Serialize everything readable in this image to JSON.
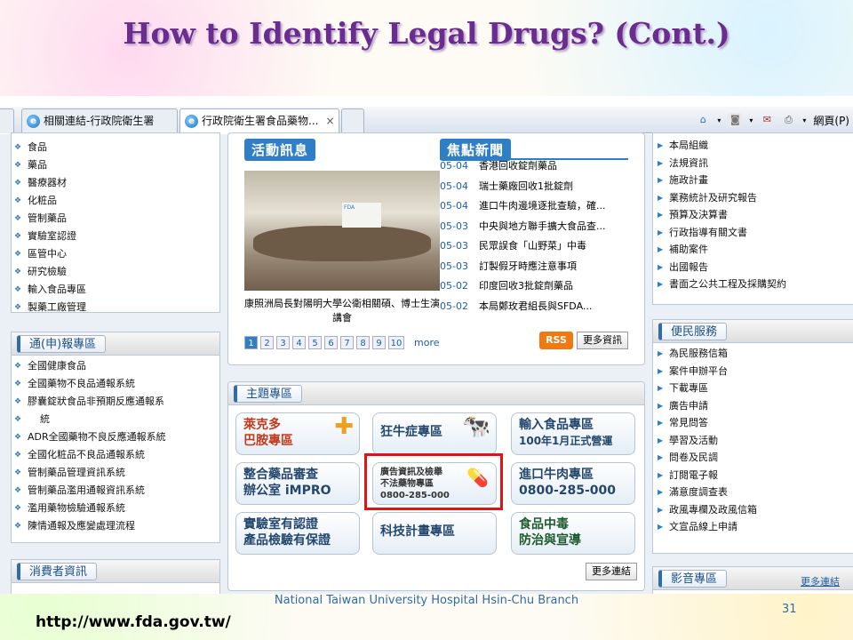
{
  "slide": {
    "title": "How to Identify Legal Drugs? (Cont.)",
    "footer": "National Taiwan University Hospital Hsin-Chu Branch",
    "page_number": "31",
    "url": "http://www.fda.gov.tw/"
  },
  "browser": {
    "tabs": [
      {
        "label": "相關連結-行政院衛生署"
      },
      {
        "label": "行政院衛生署食品藥物..."
      }
    ],
    "close": "×",
    "toolbar_page": "網頁(P)"
  },
  "left": {
    "top_items": [
      "食品",
      "藥品",
      "醫療器材",
      "化粧品",
      "管制藥品",
      "實驗室認證",
      "區管中心",
      "研究檢驗",
      "輸入食品專區",
      "製藥工廠管理"
    ],
    "report_title": "通(申)報專區",
    "report_items": [
      "全國健康食品",
      "全國藥物不良品通報系統",
      "膠囊錠狀食品非預期反應通報系",
      "統",
      "ADR全國藥物不良反應通報系統",
      "全國化粧品不良品通報系統",
      "管制藥品管理資訊系統",
      "管制藥品濫用通報資訊系統",
      "濫用藥物檢驗通報系統",
      "陳情通報及應變處理流程"
    ],
    "consumer_title": "消費者資訊"
  },
  "activity": {
    "title": "活動訊息",
    "caption": "康照洲局長對陽明大學公衛相關碩、博士生演講會",
    "pages": [
      "1",
      "2",
      "3",
      "4",
      "5",
      "6",
      "7",
      "8",
      "9",
      "10"
    ],
    "more": "more"
  },
  "news": {
    "title": "焦點新聞",
    "items": [
      {
        "date": "05-04",
        "text": "香港回收錠劑藥品"
      },
      {
        "date": "05-04",
        "text": "瑞士藥廠回收1批錠劑"
      },
      {
        "date": "05-04",
        "text": "進口牛肉邊境逐批查驗，確..."
      },
      {
        "date": "05-03",
        "text": "中央與地方聯手擴大食品查..."
      },
      {
        "date": "05-03",
        "text": "民眾誤食「山野菜」中毒"
      },
      {
        "date": "05-03",
        "text": "訂製假牙時應注意事項"
      },
      {
        "date": "05-02",
        "text": "印度回收3批錠劑藥品"
      },
      {
        "date": "05-02",
        "text": "本局鄭玫君組長與SFDA..."
      }
    ],
    "rss": "RSS",
    "more": "更多資訊"
  },
  "topics": {
    "title": "主題專區",
    "tiles": [
      {
        "line1": "萊克多",
        "line2": "巴胺專區"
      },
      {
        "line1": "狂牛症專區",
        "line2": ""
      },
      {
        "line1": "輸入食品專區",
        "line2": "100年1月正式營運"
      },
      {
        "line1": "整合藥品審查",
        "line2": "辦公室 iMPRO"
      },
      {
        "line1": "廣告資訊及檢舉",
        "line2": "不法藥物專區",
        "line3": "0800-285-000"
      },
      {
        "line1": "進口牛肉專區",
        "line2": "0800-285-000"
      },
      {
        "line1": "實驗室有認證",
        "line2": "產品檢驗有保證"
      },
      {
        "line1": "科技計畫專區",
        "line2": ""
      },
      {
        "line1": "食品中毒",
        "line2": "防治與宣導"
      }
    ],
    "more": "更多連結"
  },
  "right": {
    "top_items": [
      "本局組織",
      "法規資訊",
      "施政計畫",
      "業務統計及研究報告",
      "預算及決算書",
      "行政指導有關文書",
      "補助案件",
      "出國報告",
      "書面之公共工程及採購契約"
    ],
    "service_title": "便民服務",
    "service_items": [
      "為民服務信箱",
      "案件申辦平台",
      "下載專區",
      "廣告申請",
      "常見問答",
      "學習及活動",
      "問卷及民調",
      "訂閱電子報",
      "滿意度調查表",
      "政風專欄及政風信箱",
      "文宣品線上申請"
    ],
    "media_title": "影音專區",
    "media_more": "更多連結"
  }
}
